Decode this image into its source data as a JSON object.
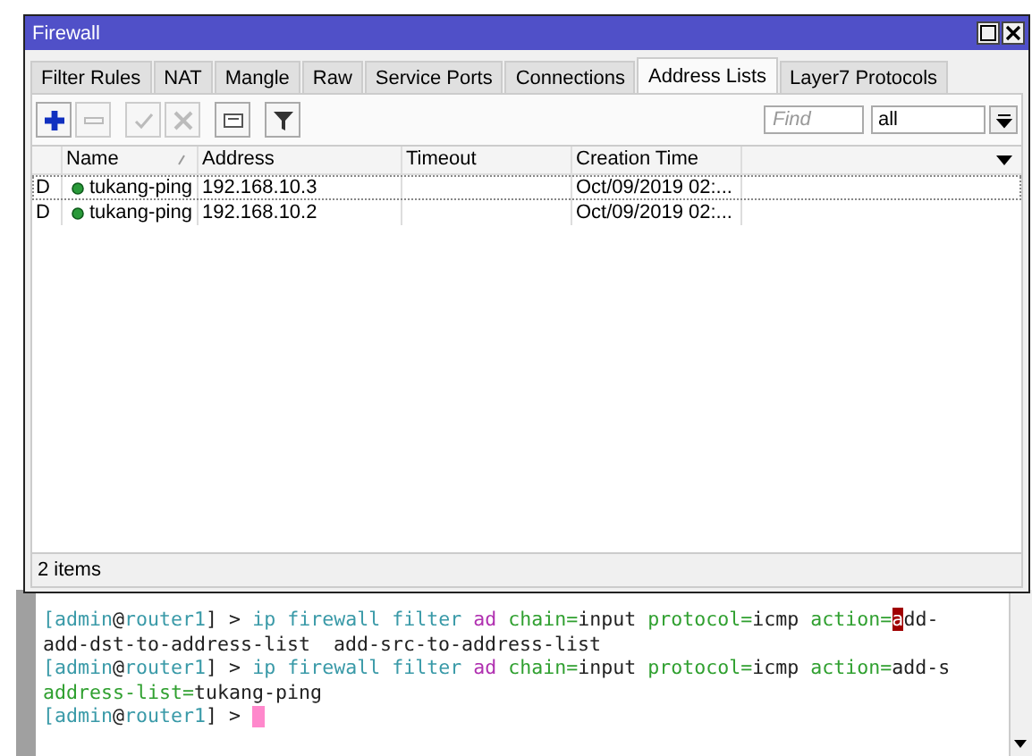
{
  "window": {
    "title": "Firewall"
  },
  "tabs": [
    {
      "label": "Filter Rules",
      "selected": false
    },
    {
      "label": "NAT",
      "selected": false
    },
    {
      "label": "Mangle",
      "selected": false
    },
    {
      "label": "Raw",
      "selected": false
    },
    {
      "label": "Service Ports",
      "selected": false
    },
    {
      "label": "Connections",
      "selected": false
    },
    {
      "label": "Address Lists",
      "selected": true
    },
    {
      "label": "Layer7 Protocols",
      "selected": false
    }
  ],
  "toolbar": [
    {
      "kind": "add",
      "disabled": false
    },
    {
      "kind": "remove",
      "disabled": true
    },
    {
      "kind": "enable",
      "disabled": true
    },
    {
      "kind": "disable",
      "disabled": true
    },
    {
      "kind": "comment",
      "disabled": false
    },
    {
      "kind": "filter",
      "disabled": false
    }
  ],
  "find": {
    "placeholder": "Find"
  },
  "list_select": {
    "value": "all"
  },
  "table": {
    "columns": [
      {
        "label": "Name",
        "sorted": true
      },
      {
        "label": "Address",
        "sorted": false
      },
      {
        "label": "Timeout",
        "sorted": false
      },
      {
        "label": "Creation Time",
        "sorted": false
      }
    ],
    "rows": [
      {
        "flag": "D",
        "name": "tukang-ping",
        "address": "192.168.10.3",
        "creation_time": "Oct/09/2019 02:...",
        "focused": true
      },
      {
        "flag": "D",
        "name": "tukang-ping",
        "address": "192.168.10.2",
        "creation_time": "Oct/09/2019 02:...",
        "focused": false
      }
    ]
  },
  "status_bar": "2 items",
  "terminal": [
    [
      {
        "kind": "path",
        "text": "[admin"
      },
      {
        "kind": "plain",
        "text": "@"
      },
      {
        "kind": "path",
        "text": "router1"
      },
      {
        "kind": "plain",
        "text": "] > "
      },
      {
        "kind": "path",
        "text": "ip firewall filter "
      },
      {
        "kind": "verb",
        "text": "ad "
      },
      {
        "kind": "arg",
        "text": "chain="
      },
      {
        "kind": "plain",
        "text": "input "
      },
      {
        "kind": "arg",
        "text": "protocol="
      },
      {
        "kind": "plain",
        "text": "icmp "
      },
      {
        "kind": "arg",
        "text": "action="
      },
      {
        "kind": "cursor",
        "text": "a"
      },
      {
        "kind": "plain",
        "text": "dd-"
      }
    ],
    [
      {
        "kind": "plain",
        "text": "add-dst-to-address-list  add-src-to-address-list"
      }
    ],
    [
      {
        "kind": "path",
        "text": "[admin"
      },
      {
        "kind": "plain",
        "text": "@"
      },
      {
        "kind": "path",
        "text": "router1"
      },
      {
        "kind": "plain",
        "text": "] > "
      },
      {
        "kind": "path",
        "text": "ip firewall filter "
      },
      {
        "kind": "verb",
        "text": "ad "
      },
      {
        "kind": "arg",
        "text": "chain="
      },
      {
        "kind": "plain",
        "text": "input "
      },
      {
        "kind": "arg",
        "text": "protocol="
      },
      {
        "kind": "plain",
        "text": "icmp "
      },
      {
        "kind": "arg",
        "text": "action="
      },
      {
        "kind": "plain",
        "text": "add-s"
      }
    ],
    [
      {
        "kind": "arg",
        "text": "address-list="
      },
      {
        "kind": "plain",
        "text": "tukang-ping"
      }
    ],
    [
      {
        "kind": "path",
        "text": "[admin"
      },
      {
        "kind": "plain",
        "text": "@"
      },
      {
        "kind": "path",
        "text": "router1"
      },
      {
        "kind": "plain",
        "text": "] > "
      }
    ]
  ]
}
